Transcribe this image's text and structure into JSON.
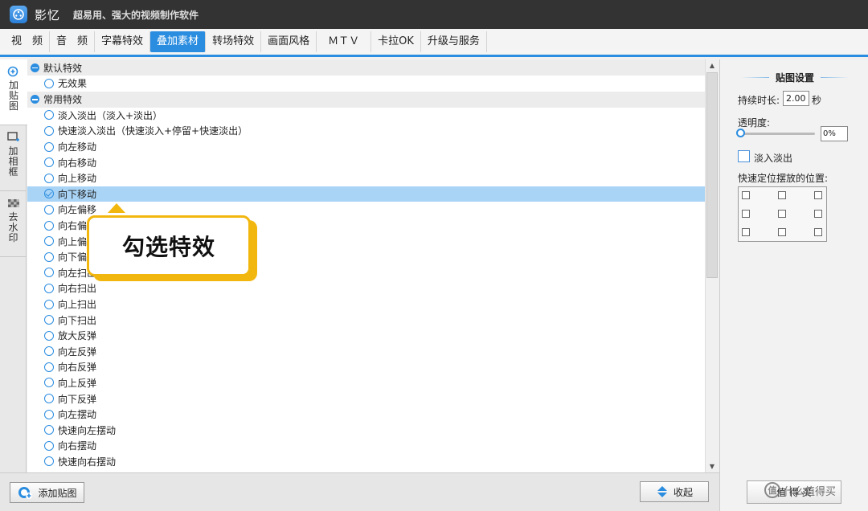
{
  "app": {
    "name": "影忆",
    "slogan": "超易用、强大的视频制作软件"
  },
  "menu": {
    "tabs": [
      {
        "label": "视　频"
      },
      {
        "label": "音　频"
      },
      {
        "label": "字幕特效"
      },
      {
        "label": "叠加素材"
      },
      {
        "label": "转场特效"
      },
      {
        "label": "画面风格"
      },
      {
        "label": "ＭＴＶ"
      },
      {
        "label": "卡拉OK"
      },
      {
        "label": "升级与服务"
      }
    ],
    "active_tab": "叠加素材"
  },
  "left_tabs": [
    {
      "label": "加贴图"
    },
    {
      "label": "加相框"
    },
    {
      "label": "去水印"
    }
  ],
  "effects": {
    "groups": [
      {
        "title": "默认特效",
        "items": [
          "无效果"
        ]
      },
      {
        "title": "常用特效",
        "items": [
          "淡入淡出（淡入+淡出）",
          "快速淡入淡出（快速淡入+停留+快速淡出）",
          "向左移动",
          "向右移动",
          "向上移动",
          "向下移动",
          "向左偏移",
          "向右偏移",
          "向上偏移",
          "向下偏移",
          "向左扫出",
          "向右扫出",
          "向上扫出",
          "向下扫出",
          "放大反弹",
          "向左反弹",
          "向右反弹",
          "向上反弹",
          "向下反弹",
          "向左摆动",
          "快速向左摆动",
          "向右摆动",
          "快速向右摆动"
        ]
      }
    ],
    "selected": "向下移动"
  },
  "callout": {
    "text": "勾选特效"
  },
  "settings": {
    "title": "贴图设置",
    "duration_label": "持续时长:",
    "duration_value": "2.00",
    "duration_unit": "秒",
    "opacity_label": "透明度:",
    "opacity_value": "0%",
    "fade_label": "淡入淡出",
    "position_label": "快速定位摆放的位置:",
    "apply_button": "值 得 买"
  },
  "bottom": {
    "add_sticker": "添加贴图",
    "collapse": "收起"
  },
  "watermark": {
    "text": "什么值得买"
  },
  "colors": {
    "accent": "#2b8de0",
    "callout": "#f2b70f",
    "selected_row": "#a9d4f6"
  }
}
